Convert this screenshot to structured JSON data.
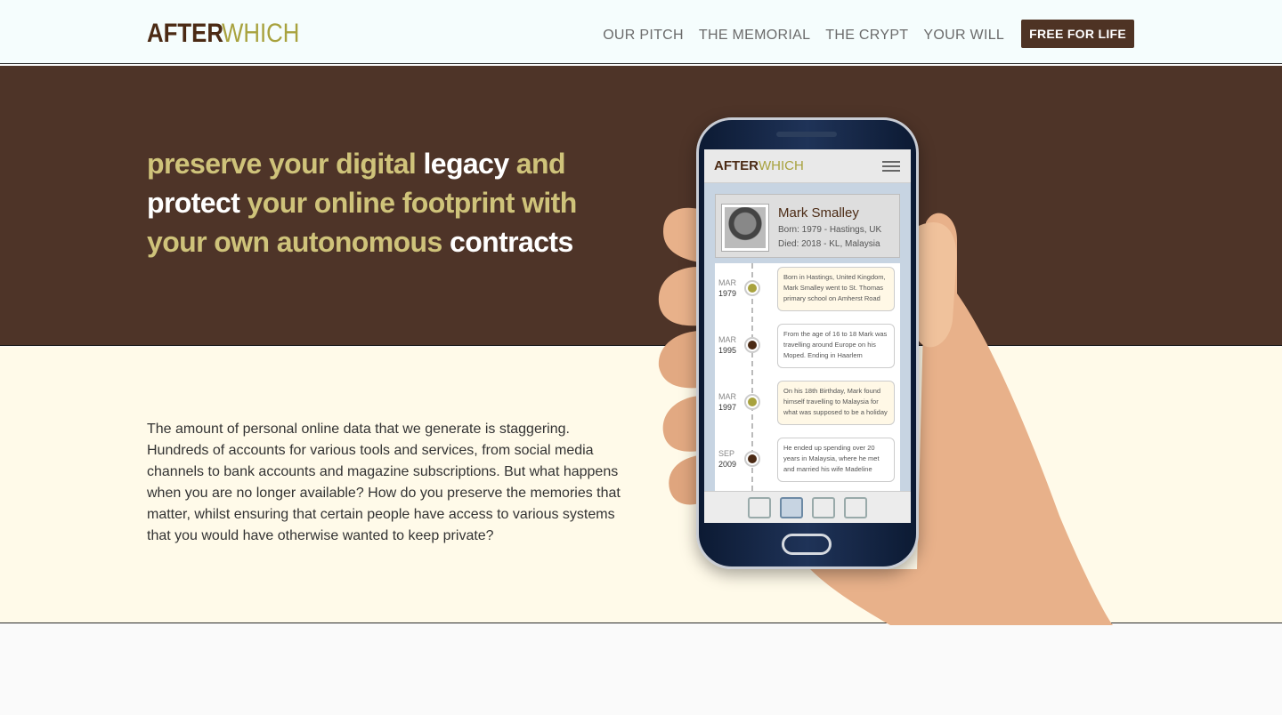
{
  "logo": {
    "part1": "AFTER",
    "part2": "WHICH"
  },
  "nav": {
    "items": [
      "OUR PITCH",
      "THE MEMORIAL",
      "THE CRYPT",
      "YOUR WILL"
    ],
    "cta": "FREE FOR LIFE"
  },
  "hero": {
    "w1": "preserve your digital ",
    "w2": "legacy",
    "w3": " and ",
    "w4": "protect",
    "w5": " your online footprint with your own autonomous ",
    "w6": "contracts"
  },
  "info": {
    "text": "The amount of personal online data that we generate is staggering. Hundreds of accounts for various tools and services, from social media channels to bank accounts and magazine subscriptions. But what happens when you are no longer available? How do you preserve the memories that matter, whilst ensuring that certain people have access to various systems that you would have otherwise wanted to keep private?"
  },
  "app": {
    "logo1": "AFTER",
    "logo2": "WHICH",
    "profile": {
      "name": "Mark Smalley",
      "born": "Born: 1979 - Hastings, UK",
      "died": "Died: 2018 - KL, Malaysia"
    },
    "timeline": [
      {
        "month": "MAR",
        "year": "1979",
        "text": "Born in Hastings, United Kingdom, Mark Smalley went to St. Thomas primary school on Amherst Road",
        "color": "#a8a23e",
        "bubble_bg": "#fff8e6"
      },
      {
        "month": "MAR",
        "year": "1995",
        "text": "From the age of 16 to 18 Mark was travelling around Europe on his Moped. Ending in Haarlem",
        "color": "#4b2a14",
        "bubble_bg": "#ffffff"
      },
      {
        "month": "MAR",
        "year": "1997",
        "text": "On his 18th Birthday, Mark found himself travelling to Malaysia for what was supposed to be a holiday",
        "color": "#a8a23e",
        "bubble_bg": "#fff8e6"
      },
      {
        "month": "SEP",
        "year": "2009",
        "text": "He ended up spending over 20 years in Malaysia, where he met and married his wife Madeline",
        "color": "#4b2a14",
        "bubble_bg": "#ffffff"
      }
    ],
    "tabs": [
      "monitor-icon",
      "people-icon",
      "inbox-icon",
      "server-icon"
    ]
  },
  "colors": {
    "brand_brown": "#4e3428",
    "brand_olive": "#a8a23e",
    "hero_text": "#cfc37a",
    "info_bg": "#fffae9"
  }
}
